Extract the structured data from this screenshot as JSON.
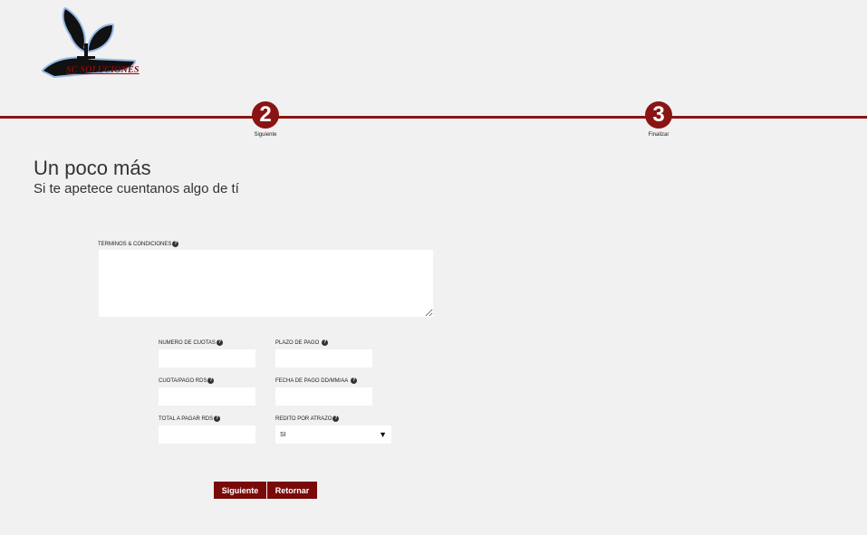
{
  "logo": {
    "text": "SC SOLUCIONES",
    "icon": "plant-in-hand-icon"
  },
  "steps": [
    {
      "number": "2",
      "label": "Siguiente"
    },
    {
      "number": "3",
      "label": "Finalizar"
    }
  ],
  "heading": {
    "title": "Un poco más",
    "subtitle": "Si te apetece cuentanos algo de tí"
  },
  "form": {
    "terms_label": "TERMINOS & CONDICIONES",
    "terms_value": "",
    "num_cuotas_label": "NUMERO DE CUOTAS",
    "plazo_pago_label": "PLAZO DE PAGO",
    "cuota_pago_label": "CUOTA/PAGO RDS",
    "fecha_pago_label": "FECHA DE PAGO DD/MM/AA",
    "total_pagar_label": "TOTAL A PAGAR RDS",
    "redito_label": "REDITO POR ATRAZO",
    "redito_value": "SI",
    "help_glyph": "?"
  },
  "buttons": {
    "next": "Siguiente",
    "back": "Retornar"
  },
  "colors": {
    "accent": "#8a1414",
    "button": "#7a0a0a",
    "background": "#f1f1f1"
  }
}
